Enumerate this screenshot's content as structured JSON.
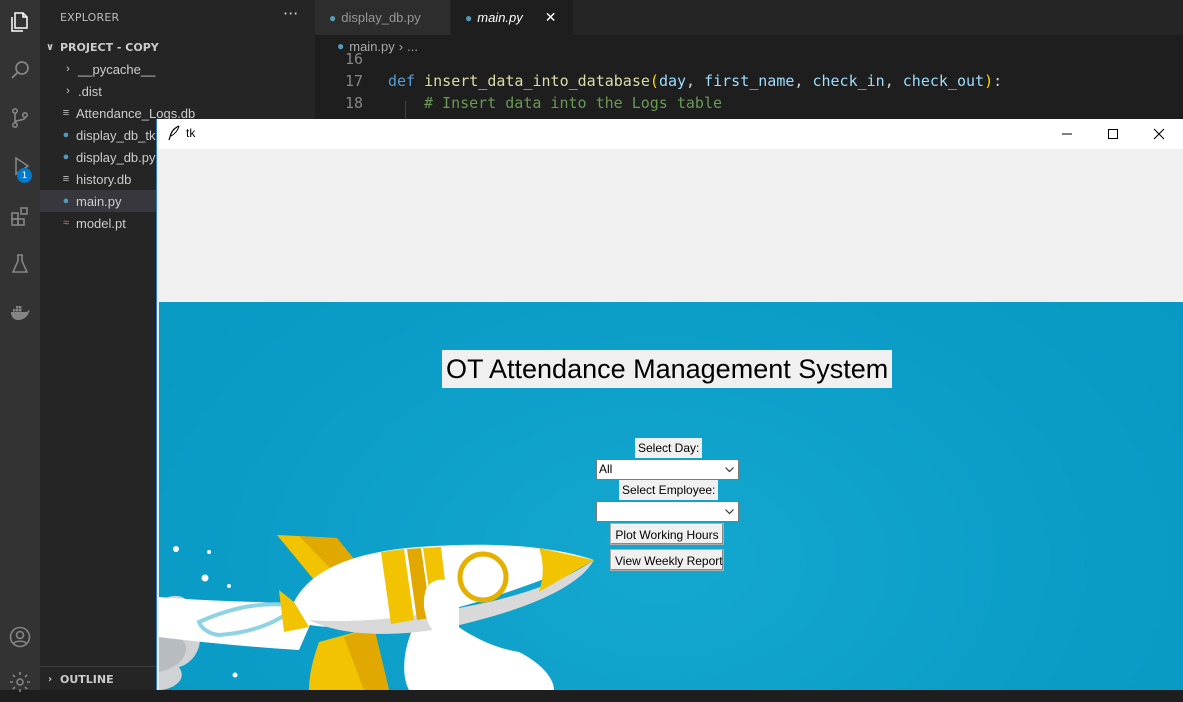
{
  "activity_bar": {
    "icons": [
      "files-icon",
      "search-icon",
      "source-control-icon",
      "run-debug-icon",
      "extensions-icon",
      "testing-icon",
      "docker-icon",
      "account-icon",
      "settings-gear-icon"
    ],
    "debug_badge": "1"
  },
  "sidebar": {
    "header": "EXPLORER",
    "more": "···",
    "project": "PROJECT - COPY",
    "items": [
      {
        "label": "__pycache__",
        "kind": "folder"
      },
      {
        "label": ".dist",
        "kind": "folder"
      },
      {
        "label": "Attendance_Logs.db",
        "kind": "db"
      },
      {
        "label": "display_db_tki",
        "kind": "python"
      },
      {
        "label": "display_db.py",
        "kind": "python"
      },
      {
        "label": "history.db",
        "kind": "db"
      },
      {
        "label": "main.py",
        "kind": "python",
        "selected": true
      },
      {
        "label": "model.pt",
        "kind": "rss"
      }
    ],
    "outline": "OUTLINE"
  },
  "editor": {
    "tabs": [
      {
        "label": "display_db.py",
        "active": false
      },
      {
        "label": "main.py",
        "active": true
      }
    ],
    "breadcrumb": {
      "file": "main.py",
      "sep": "›",
      "rest": "..."
    },
    "lines": [
      {
        "num": "16"
      },
      {
        "num": "17",
        "kw": "def",
        "fn": "insert_data_into_database",
        "open": "(",
        "p1": "day",
        "c1": ", ",
        "p2": "first_name",
        "c2": ", ",
        "p3": "check_in",
        "c3": ", ",
        "p4": "check_out",
        "close": ")",
        "colon": ":"
      },
      {
        "num": "18",
        "comment": "# Insert data into the Logs table"
      }
    ]
  },
  "tk_window": {
    "title": "tk",
    "controls": {
      "minimize": "minimize-icon",
      "maximize": "maximize-icon",
      "close": "close-icon"
    },
    "app_title": "OT Attendance Management System",
    "select_day_label": "Select Day:",
    "select_day_value": "All",
    "select_employee_label": "Select Employee:",
    "select_employee_value": "",
    "plot_button": "Plot Working Hours",
    "report_button": "View Weekly Report"
  },
  "colors": {
    "vscode_bg": "#1e1e1e",
    "sidebar_bg": "#252526",
    "activity_bg": "#333333",
    "accent_blue": "#007acc",
    "canvas_blue": "#0b9dc7",
    "rocket_yellow": "#f2c300"
  }
}
